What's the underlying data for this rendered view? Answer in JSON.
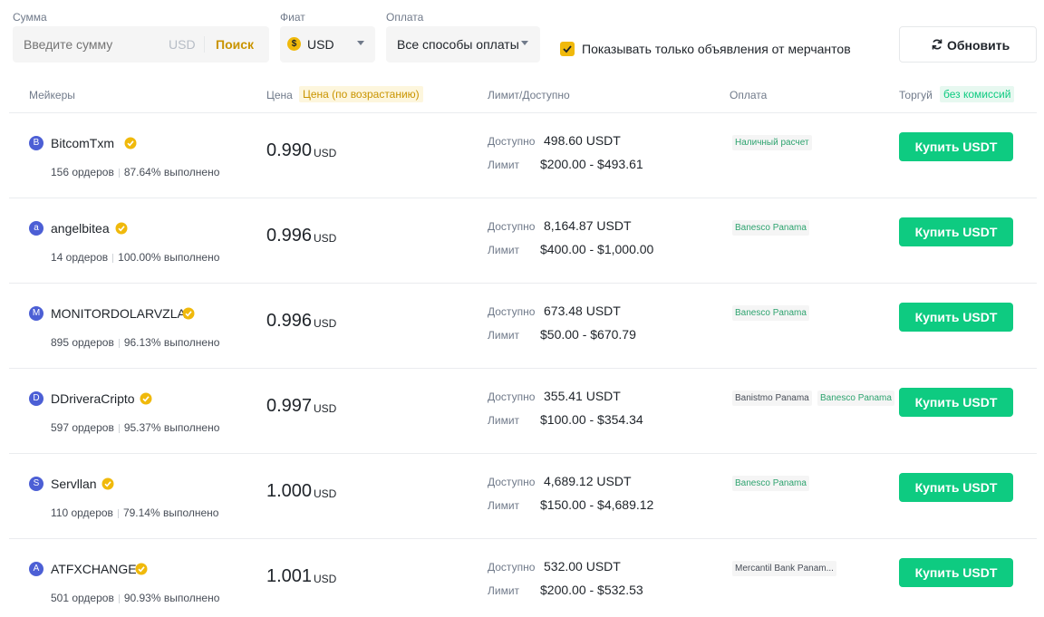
{
  "filters": {
    "amount_label": "Сумма",
    "amount_placeholder": "Введите сумму",
    "amount_unit": "USD",
    "search_button": "Поиск",
    "fiat_label": "Фиат",
    "fiat_value": "USD",
    "fiat_icon": "$",
    "payment_label": "Оплата",
    "payment_value": "Все способы оплаты",
    "merchant_only_label": "Показывать только объявления от мерчантов",
    "merchant_only_checked": true,
    "refresh_button": "Обновить"
  },
  "table_header": {
    "makers": "Мейкеры",
    "price": "Цена",
    "price_sort": "Цена (по возрастанию)",
    "limit": "Лимит/Доступно",
    "payment": "Оплата",
    "trade": "Торгуй",
    "no_fee": "без комиссий"
  },
  "labels": {
    "available": "Доступно",
    "limit": "Лимит",
    "price_unit": "USD",
    "buy": "Купить USDT"
  },
  "offers": [
    {
      "avatar": "B",
      "name": "BitcomTxm",
      "orders": "156 ордеров",
      "completion": "87.64% выполнено",
      "price": "0.990",
      "available": "498.60 USDT",
      "limit": "$200.00 - $493.61",
      "payments": [
        "Наличный расчет"
      ]
    },
    {
      "avatar": "a",
      "name": "angelbitea",
      "orders": "14 ордеров",
      "completion": "100.00% выполнено",
      "price": "0.996",
      "available": "8,164.87 USDT",
      "limit": "$400.00 - $1,000.00",
      "payments": [
        "Banesco Panama"
      ]
    },
    {
      "avatar": "M",
      "name": "MONITORDOLARVZLA",
      "orders": "895 ордеров",
      "completion": "96.13% выполнено",
      "price": "0.996",
      "available": "673.48 USDT",
      "limit": "$50.00 - $670.79",
      "payments": [
        "Banesco Panama"
      ]
    },
    {
      "avatar": "D",
      "name": "DDriveraCripto",
      "orders": "597 ордеров",
      "completion": "95.37% выполнено",
      "price": "0.997",
      "available": "355.41 USDT",
      "limit": "$100.00 - $354.34",
      "payments": [
        "Banistmo Panama",
        "Banesco Panama"
      ]
    },
    {
      "avatar": "S",
      "name": "Servllan",
      "orders": "110 ордеров",
      "completion": "79.14% выполнено",
      "price": "1.000",
      "available": "4,689.12 USDT",
      "limit": "$150.00 - $4,689.12",
      "payments": [
        "Banesco Panama"
      ]
    },
    {
      "avatar": "A",
      "name": "ATFXCHANGE",
      "orders": "501 ордеров",
      "completion": "90.93% выполнено",
      "price": "1.001",
      "available": "532.00 USDT",
      "limit": "$200.00 - $532.53",
      "payments": [
        "Mercantil Bank Panam..."
      ]
    }
  ],
  "colors": {
    "accent_yellow": "#f0b90b",
    "search_text": "#c99400",
    "buy_green": "#0ecb81",
    "avatar_blue": "#4c5fd5",
    "payment_tag_green": "#2ea36f"
  }
}
